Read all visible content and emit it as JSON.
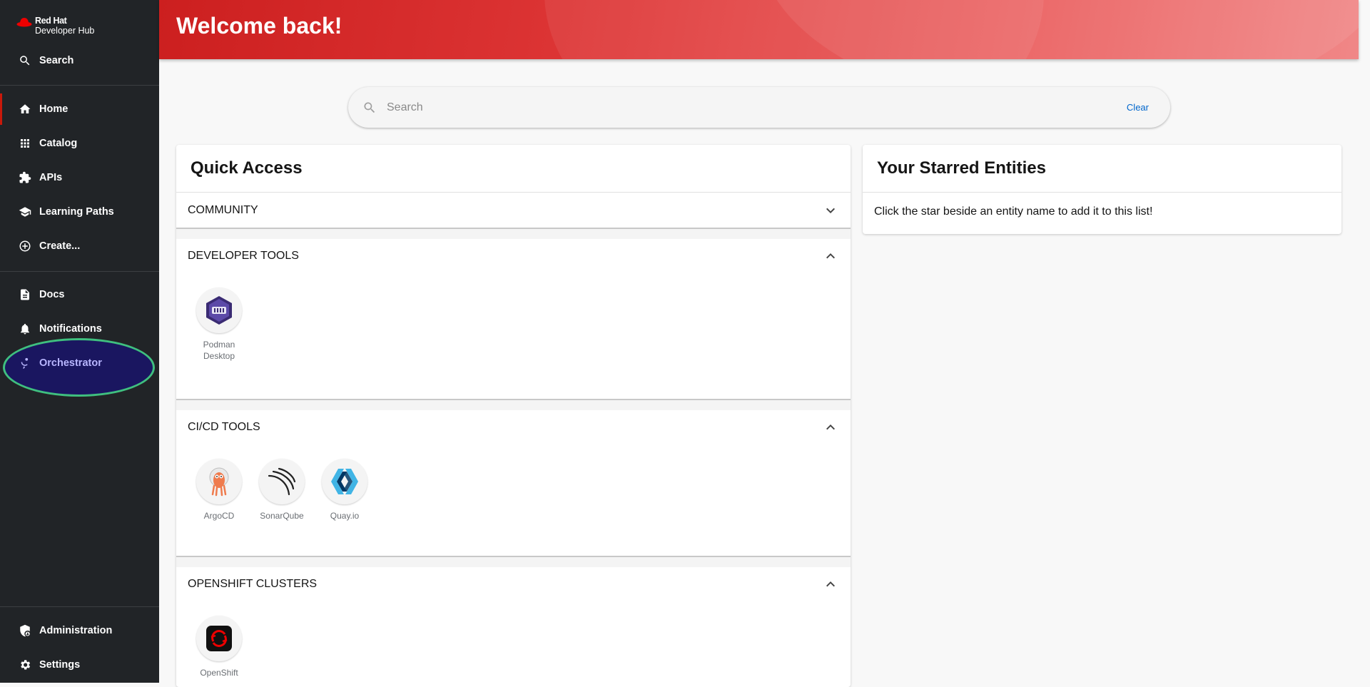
{
  "brand": {
    "line1": "Red Hat",
    "line2": "Developer Hub"
  },
  "sidebar": {
    "search_label": "Search",
    "items": [
      {
        "label": "Home",
        "icon": "home-icon"
      },
      {
        "label": "Catalog",
        "icon": "grid-icon"
      },
      {
        "label": "APIs",
        "icon": "puzzle-icon"
      },
      {
        "label": "Learning Paths",
        "icon": "school-icon"
      },
      {
        "label": "Create...",
        "icon": "add-circle-icon"
      },
      {
        "label": "Docs",
        "icon": "document-icon"
      },
      {
        "label": "Notifications",
        "icon": "bell-icon"
      },
      {
        "label": "Orchestrator",
        "icon": "orchestrator-icon"
      }
    ],
    "bottom": [
      {
        "label": "Administration",
        "icon": "admin-icon"
      },
      {
        "label": "Settings",
        "icon": "gear-icon"
      }
    ]
  },
  "header": {
    "title": "Welcome back!"
  },
  "search": {
    "placeholder": "Search",
    "clear_label": "Clear"
  },
  "quick_access": {
    "title": "Quick Access",
    "sections": [
      {
        "title": "COMMUNITY",
        "expanded": false,
        "items": []
      },
      {
        "title": "DEVELOPER TOOLS",
        "expanded": true,
        "items": [
          {
            "line1": "Podman",
            "line2": "Desktop"
          }
        ]
      },
      {
        "title": "CI/CD TOOLS",
        "expanded": true,
        "items": [
          {
            "label": "ArgoCD"
          },
          {
            "label": "SonarQube"
          },
          {
            "label": "Quay.io"
          }
        ]
      },
      {
        "title": "OPENSHIFT CLUSTERS",
        "expanded": true,
        "items": [
          {
            "label": "OpenShift"
          }
        ]
      }
    ]
  },
  "starred": {
    "title": "Your Starred Entities",
    "empty_text": "Click the star beside an entity name to add it to this list!"
  },
  "colors": {
    "sidebar_bg": "#212427",
    "brand_red": "#ee0000",
    "link_blue": "#0066cc",
    "highlight": "#3fbf7f"
  }
}
